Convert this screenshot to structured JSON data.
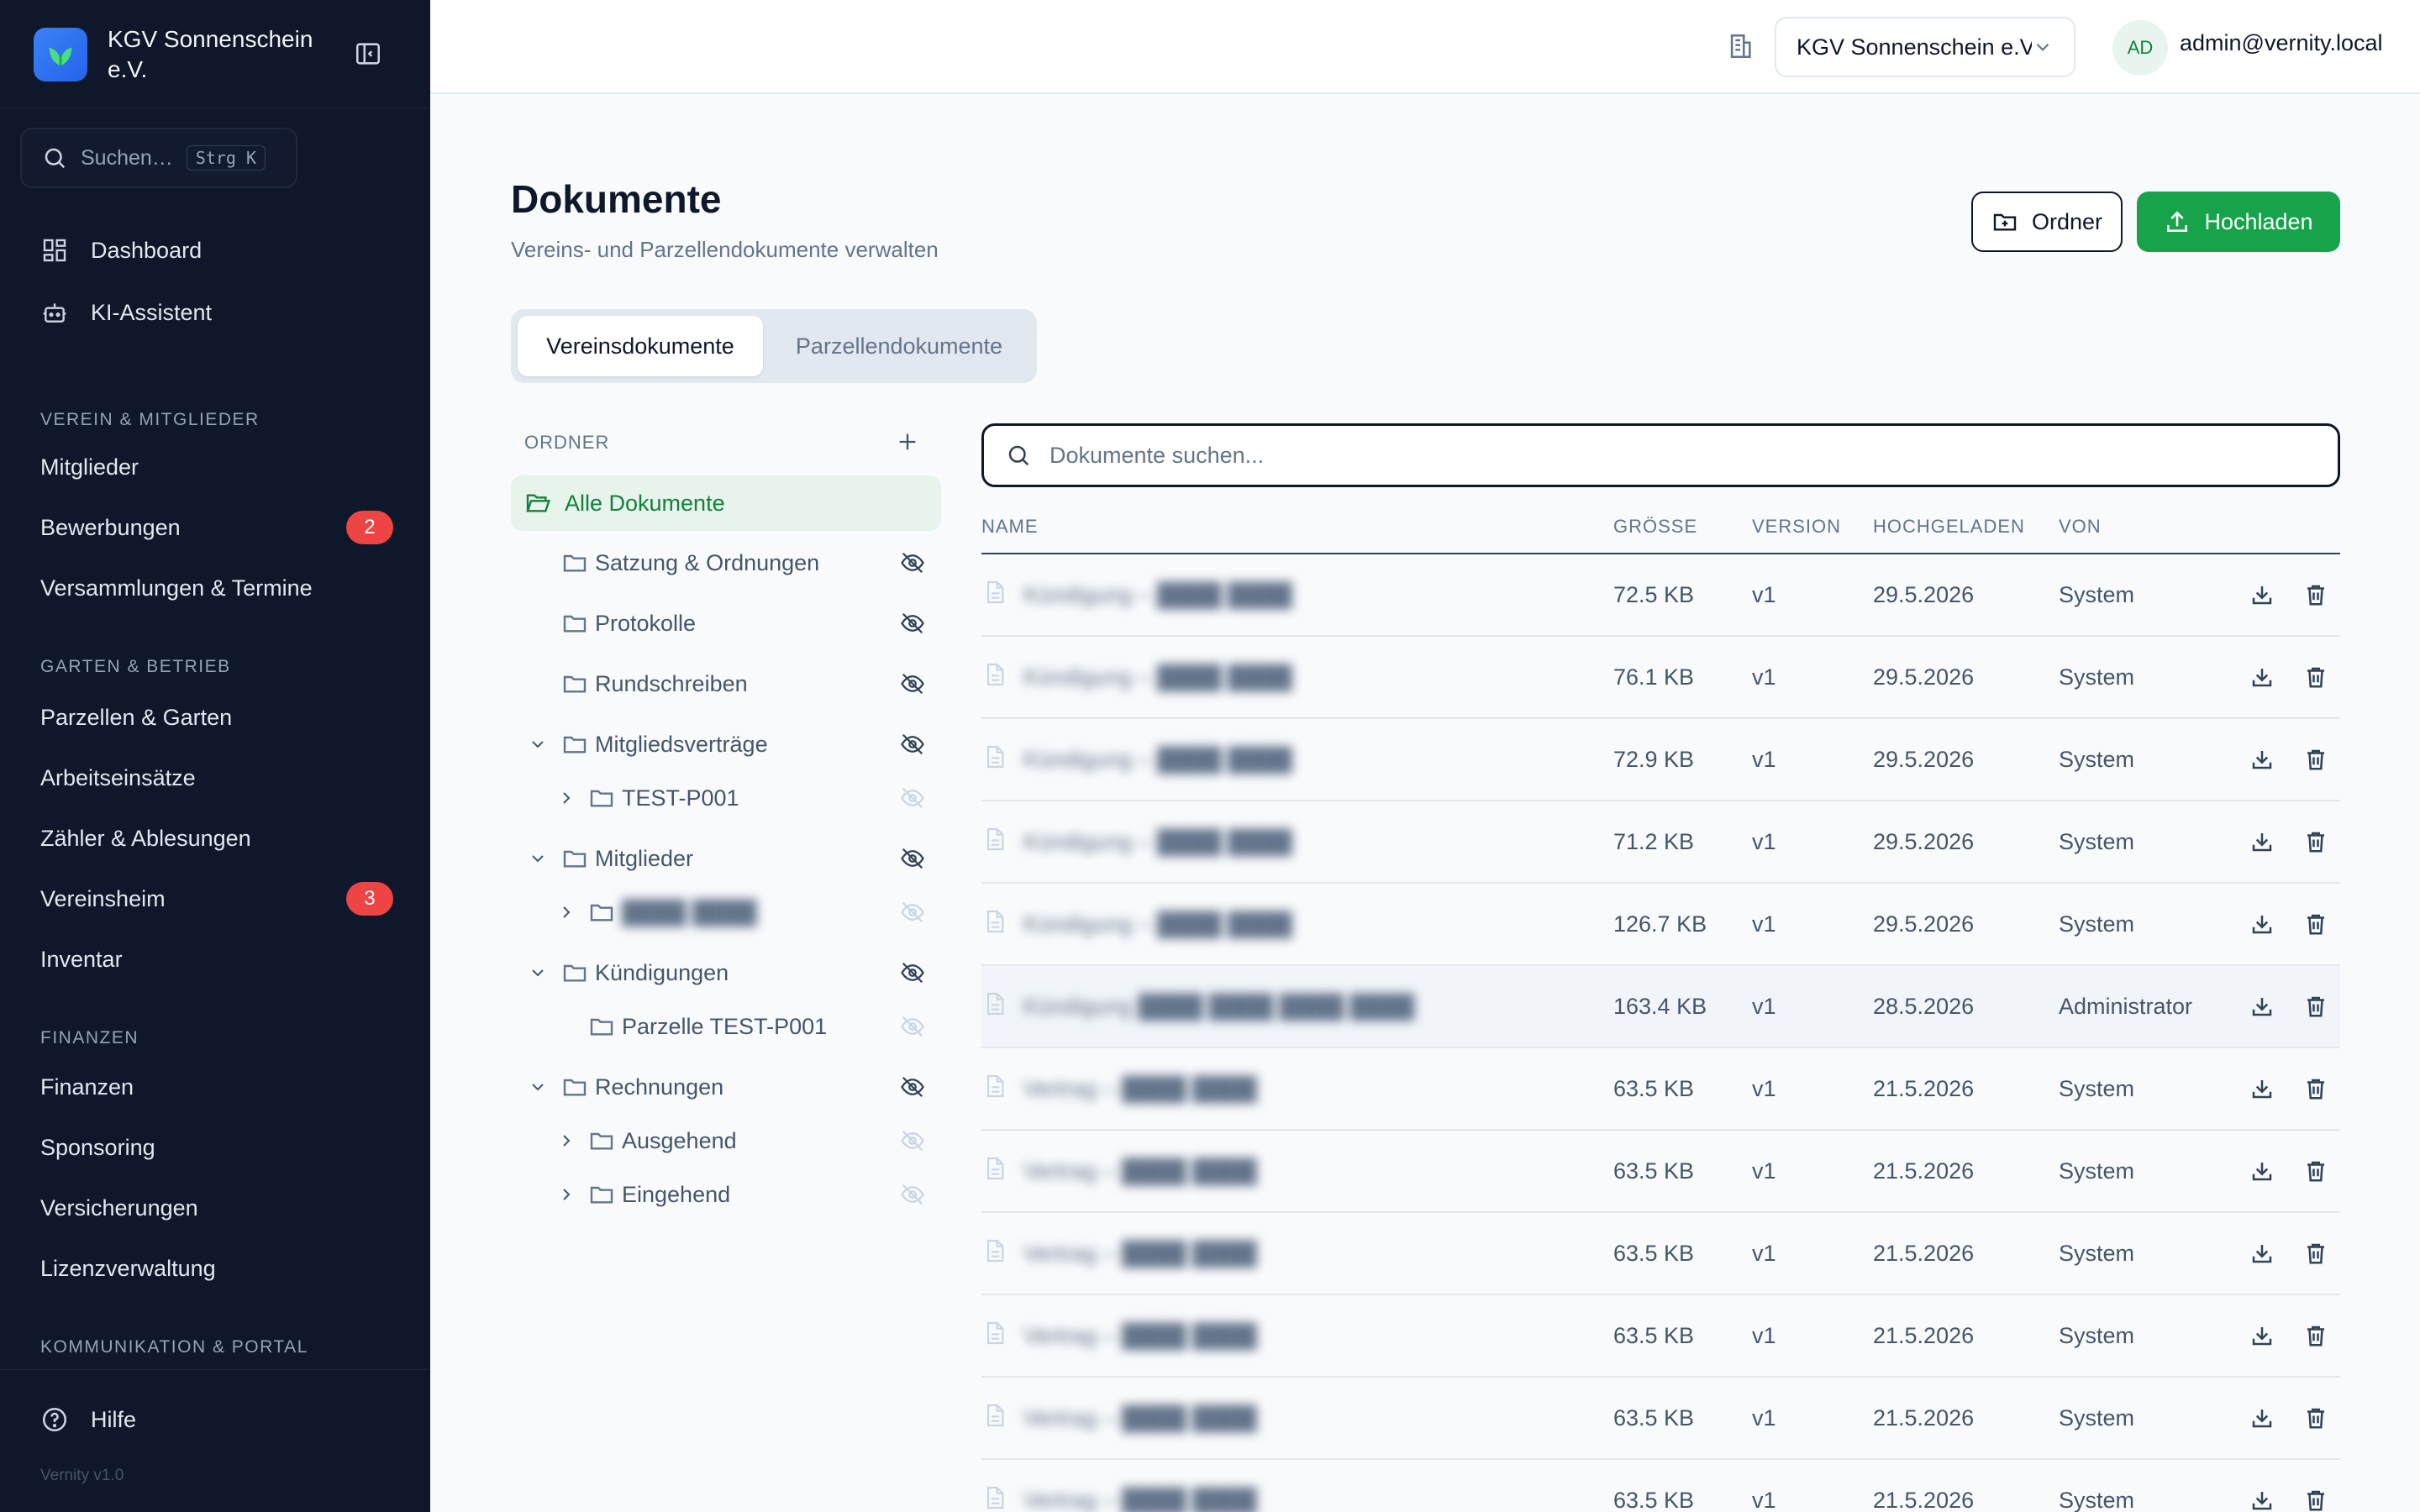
{
  "brand": {
    "name": "KGV Sonnenschein e.V."
  },
  "sidebar": {
    "search_placeholder": "Suchen…",
    "search_shortcut": "Strg K",
    "top_items": [
      {
        "label": "Dashboard",
        "icon": "dashboard-icon"
      },
      {
        "label": "KI-Assistent",
        "icon": "bot-icon"
      }
    ],
    "sections": [
      {
        "title": "VEREIN & MITGLIEDER",
        "items": [
          {
            "label": "Mitglieder"
          },
          {
            "label": "Bewerbungen",
            "badge": "2"
          },
          {
            "label": "Versammlungen & Termine"
          }
        ]
      },
      {
        "title": "GARTEN & BETRIEB",
        "items": [
          {
            "label": "Parzellen & Garten"
          },
          {
            "label": "Arbeitseinsätze"
          },
          {
            "label": "Zähler & Ablesungen"
          },
          {
            "label": "Vereinsheim",
            "badge": "3"
          },
          {
            "label": "Inventar"
          }
        ]
      },
      {
        "title": "FINANZEN",
        "items": [
          {
            "label": "Finanzen"
          },
          {
            "label": "Sponsoring"
          },
          {
            "label": "Versicherungen"
          },
          {
            "label": "Lizenzverwaltung"
          }
        ]
      },
      {
        "title": "KOMMUNIKATION & PORTAL",
        "items": []
      }
    ],
    "help_label": "Hilfe",
    "version": "Vernity v1.0"
  },
  "topbar": {
    "org_value": "KGV Sonnenschein e.V.",
    "avatar_initials": "AD",
    "user_email": "admin@vernity.local"
  },
  "main": {
    "title": "Dokumente",
    "subtitle": "Vereins- und Parzellendokumente verwalten",
    "folder_button": "Ordner",
    "upload_button": "Hochladen",
    "tabs": [
      {
        "label": "Vereinsdokumente",
        "active": true
      },
      {
        "label": "Parzellendokumente",
        "active": false
      }
    ]
  },
  "tree": {
    "heading": "ORDNER",
    "all_label": "Alle Dokumente",
    "folders": [
      {
        "label": "Satzung & Ordnungen",
        "depth": 1,
        "chevron": "none"
      },
      {
        "label": "Protokolle",
        "depth": 1,
        "chevron": "none"
      },
      {
        "label": "Rundschreiben",
        "depth": 1,
        "chevron": "none"
      },
      {
        "label": "Mitgliedsverträge",
        "depth": 1,
        "chevron": "down"
      },
      {
        "label": "TEST-P001",
        "depth": 2,
        "chevron": "right"
      },
      {
        "label": "Mitglieder",
        "depth": 1,
        "chevron": "down"
      },
      {
        "label": "████ ████",
        "depth": 2,
        "chevron": "right",
        "blurred": true
      },
      {
        "label": "Kündigungen",
        "depth": 1,
        "chevron": "down"
      },
      {
        "label": "Parzelle TEST-P001",
        "depth": 2,
        "chevron": "none"
      },
      {
        "label": "Rechnungen",
        "depth": 1,
        "chevron": "down"
      },
      {
        "label": "Ausgehend",
        "depth": 2,
        "chevron": "right"
      },
      {
        "label": "Eingehend",
        "depth": 2,
        "chevron": "right"
      }
    ]
  },
  "documents": {
    "search_placeholder": "Dokumente suchen...",
    "columns": {
      "name": "NAME",
      "size": "GRÖSSE",
      "version": "VERSION",
      "uploaded": "HOCHGELADEN",
      "by": "VON"
    },
    "rows": [
      {
        "name": "Kündigung – ████ ████",
        "size": "72.5 KB",
        "version": "v1",
        "uploaded": "29.5.2026",
        "by": "System"
      },
      {
        "name": "Kündigung – ████ ████",
        "size": "76.1 KB",
        "version": "v1",
        "uploaded": "29.5.2026",
        "by": "System"
      },
      {
        "name": "Kündigung – ████ ████",
        "size": "72.9 KB",
        "version": "v1",
        "uploaded": "29.5.2026",
        "by": "System"
      },
      {
        "name": "Kündigung – ████ ████",
        "size": "71.2 KB",
        "version": "v1",
        "uploaded": "29.5.2026",
        "by": "System"
      },
      {
        "name": "Kündigung – ████ ████",
        "size": "126.7 KB",
        "version": "v1",
        "uploaded": "29.5.2026",
        "by": "System"
      },
      {
        "name": "Kündigung ████ ████ ████ ████",
        "size": "163.4 KB",
        "version": "v1",
        "uploaded": "28.5.2026",
        "by": "Administrator",
        "highlighted": true
      },
      {
        "name": "Vertrag – ████ ████",
        "size": "63.5 KB",
        "version": "v1",
        "uploaded": "21.5.2026",
        "by": "System"
      },
      {
        "name": "Vertrag – ████ ████",
        "size": "63.5 KB",
        "version": "v1",
        "uploaded": "21.5.2026",
        "by": "System"
      },
      {
        "name": "Vertrag – ████ ████",
        "size": "63.5 KB",
        "version": "v1",
        "uploaded": "21.5.2026",
        "by": "System"
      },
      {
        "name": "Vertrag – ████ ████",
        "size": "63.5 KB",
        "version": "v1",
        "uploaded": "21.5.2026",
        "by": "System"
      },
      {
        "name": "Vertrag – ████ ████",
        "size": "63.5 KB",
        "version": "v1",
        "uploaded": "21.5.2026",
        "by": "System"
      },
      {
        "name": "Vertrag – ████ ████",
        "size": "63.5 KB",
        "version": "v1",
        "uploaded": "21.5.2026",
        "by": "System"
      }
    ]
  },
  "colors": {
    "sidebar_bg": "#0f172a",
    "accent_green": "#16a34a",
    "badge_red": "#ef4444",
    "brand_blue": "#2563eb"
  }
}
